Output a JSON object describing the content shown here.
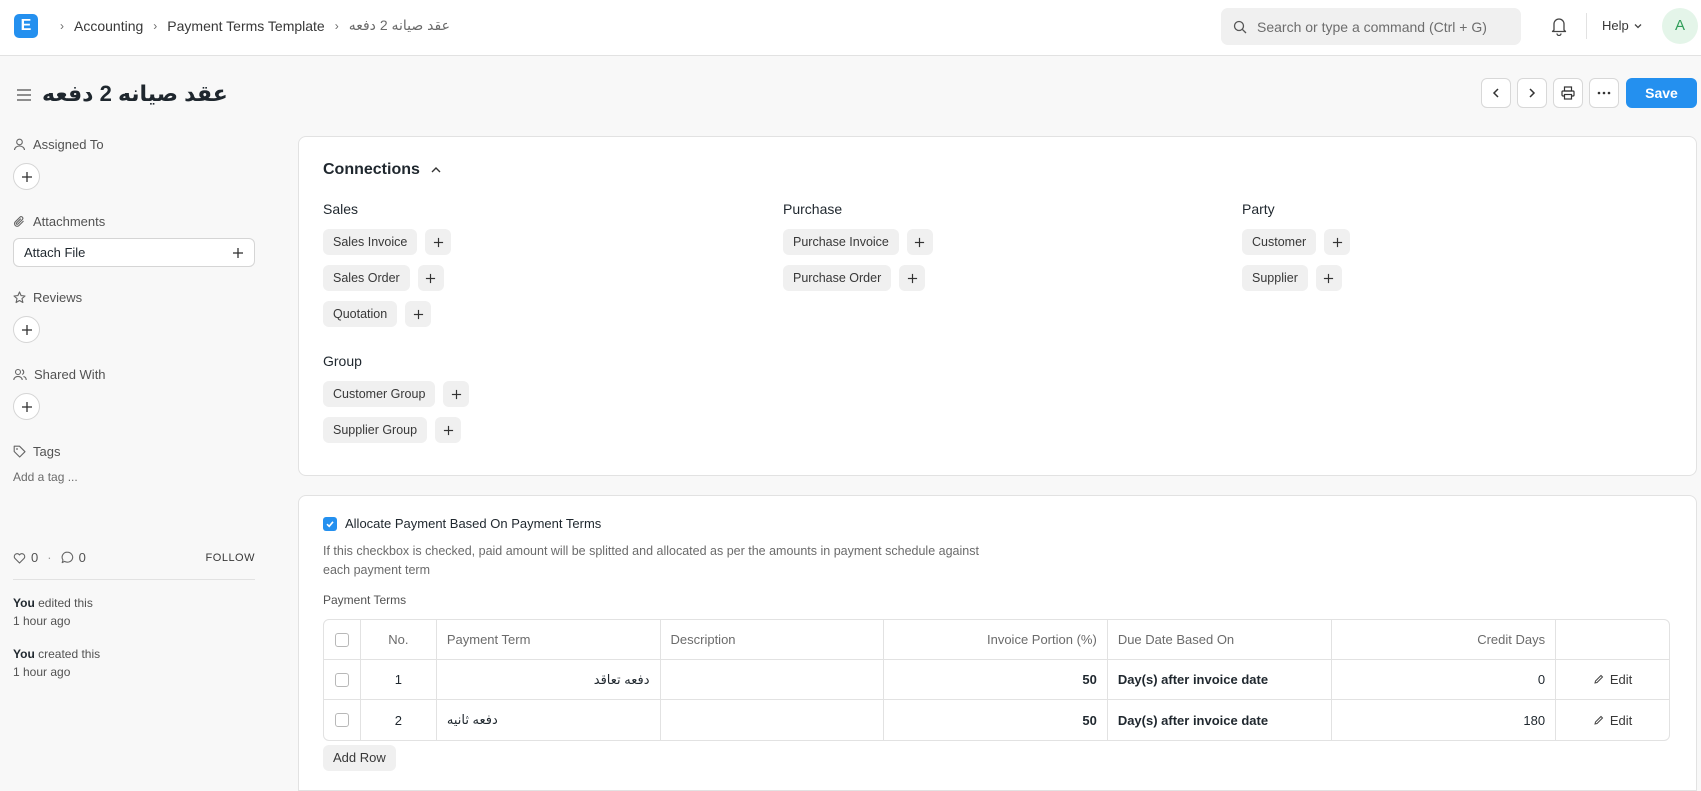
{
  "navbar": {
    "logo_letter": "E",
    "breadcrumbs": [
      "Accounting",
      "Payment Terms Template",
      "عقد صيانه 2 دفعه"
    ],
    "search_placeholder": "Search or type a command (Ctrl + G)",
    "help_label": "Help",
    "avatar_letter": "A"
  },
  "page": {
    "title": "عقد صيانه 2 دفعه",
    "save_label": "Save"
  },
  "sidebar": {
    "assigned_to": "Assigned To",
    "attachments": "Attachments",
    "attach_file": "Attach File",
    "reviews": "Reviews",
    "shared_with": "Shared With",
    "tags": "Tags",
    "add_tag": "Add a tag ...",
    "likes": "0",
    "comments": "0",
    "follow": "FOLLOW",
    "activity": [
      {
        "who": "You",
        "action": " edited this",
        "when": "1 hour ago"
      },
      {
        "who": "You",
        "action": " created this",
        "when": "1 hour ago"
      }
    ]
  },
  "connections": {
    "title": "Connections",
    "groups": [
      {
        "heading": "Sales",
        "items": [
          "Sales Invoice",
          "Sales Order",
          "Quotation"
        ]
      },
      {
        "heading": "Purchase",
        "items": [
          "Purchase Invoice",
          "Purchase Order"
        ]
      },
      {
        "heading": "Party",
        "items": [
          "Customer",
          "Supplier"
        ]
      },
      {
        "heading": "Group",
        "items": [
          "Customer Group",
          "Supplier Group"
        ]
      }
    ]
  },
  "payment": {
    "allocate_label": "Allocate Payment Based On Payment Terms",
    "allocate_checked": true,
    "allocate_desc": "If this checkbox is checked, paid amount will be splitted and allocated as per the amounts in payment schedule against each payment term",
    "terms_label": "Payment Terms",
    "columns": [
      "No.",
      "Payment Term",
      "Description",
      "Invoice Portion (%)",
      "Due Date Based On",
      "Credit Days"
    ],
    "rows": [
      {
        "no": "1",
        "term": "دفعه تعاقد",
        "description": "",
        "portion": "50",
        "due_based_on": "Day(s) after invoice date",
        "credit_days": "0",
        "edit": "Edit"
      },
      {
        "no": "2",
        "term": "دفعه ثانيه",
        "description": "",
        "portion": "50",
        "due_based_on": "Day(s) after invoice date",
        "credit_days": "180",
        "edit": "Edit"
      }
    ],
    "add_row": "Add Row"
  }
}
